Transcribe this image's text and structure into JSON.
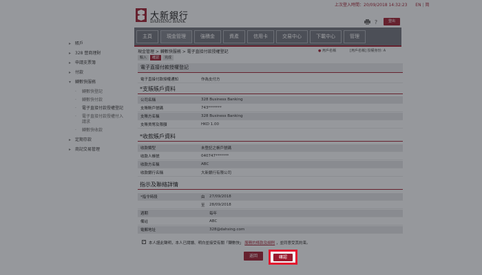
{
  "header": {
    "last_login": "上次登入時間：20/09/2018 14:32:23",
    "lang_en": "EN",
    "lang_sep": "|",
    "lang_cn": "简",
    "logo_cn": "大新銀行",
    "logo_en": "DAHSING BANK",
    "logout": "登出",
    "help_icon": "?"
  },
  "nav": {
    "items": [
      "主頁",
      "現金管理",
      "強積金",
      "資產",
      "信用卡",
      "交易中心",
      "下載中心",
      "管理"
    ],
    "active_index": 1
  },
  "sidebar": {
    "items": [
      {
        "label": "賬戶",
        "type": "parent",
        "expanded": false
      },
      {
        "label": "328 營商理財",
        "type": "parent",
        "expanded": false
      },
      {
        "label": "申請支票簿",
        "type": "parent",
        "expanded": false
      },
      {
        "label": "付款",
        "type": "parent",
        "expanded": false
      },
      {
        "label": "轉數快服務",
        "type": "parent",
        "expanded": true
      },
      {
        "label": "轉數快登記",
        "type": "sub"
      },
      {
        "label": "轉數快付款",
        "type": "sub"
      },
      {
        "label": "電子直接付款授權登記",
        "type": "sub",
        "current": true
      },
      {
        "label": "電子直接付款授權付入",
        "type": "sub"
      },
      {
        "label": "請求",
        "type": "sub-cont"
      },
      {
        "label": "轉數快收款",
        "type": "sub"
      },
      {
        "label": "定期存款",
        "type": "parent",
        "expanded": false
      },
      {
        "label": "商記交易管理",
        "type": "parent",
        "expanded": false
      }
    ]
  },
  "main": {
    "breadcrumb": "現金管理 > 轉數快服務 > 電子直接付款授權登記",
    "user_label": "用戶名稱",
    "user_value": "[用戶名稱]  授權身份: A",
    "steps": [
      "輸入",
      "確認",
      "完成"
    ],
    "active_step": 1,
    "page_title": "電子直接付款授權登記",
    "role_label": "電子直接付款授權通知",
    "role_value": "作為支付方",
    "debtor_section": "*支賬賬戶資料",
    "debtor_rows": [
      {
        "label": "公司名稱",
        "value": "328 Business Banking"
      },
      {
        "label": "支賬賬戶號碼",
        "value": "743*******"
      },
      {
        "label": "支賬方名稱",
        "value": "328 Business Banking"
      },
      {
        "label": "支賬貨幣及限額",
        "value": "HKD 1.00"
      }
    ],
    "creditor_section": "*收款賬戶資料",
    "creditor_rows": [
      {
        "label": "收款類型",
        "value": "未登記之帳戶號碼"
      },
      {
        "label": "收款人帳號",
        "value": "040747*******"
      },
      {
        "label": "收款方名稱",
        "value": "ABC"
      },
      {
        "label": "收款銀行名稱",
        "value": "大新銀行有限公司"
      }
    ],
    "instr_section": "指示及聯絡詳情",
    "instr_rows": [
      {
        "label": "*指令時段",
        "prefix": "由",
        "value": "27/09/2018"
      },
      {
        "label": "",
        "prefix": "至",
        "value": "28/09/2018"
      },
      {
        "label": "週期",
        "prefix": "",
        "value": "每年"
      },
      {
        "label": "備註",
        "prefix": "",
        "value": "ABC"
      },
      {
        "label": "電郵地址",
        "prefix": "",
        "value": "328@dahsing.com"
      }
    ],
    "declaration_pre": "本人謹此聲明，本人已閱讀、明白並接受有關「轉數快」",
    "declaration_link": "服務的條款及細則",
    "declaration_post": "，並同意受其約束。",
    "back_button": "返回",
    "confirm_button": "確認"
  },
  "colors": {
    "brand": "#9b1b2e",
    "nav_bg": "#6b6f78",
    "highlight": "#e3152f"
  }
}
